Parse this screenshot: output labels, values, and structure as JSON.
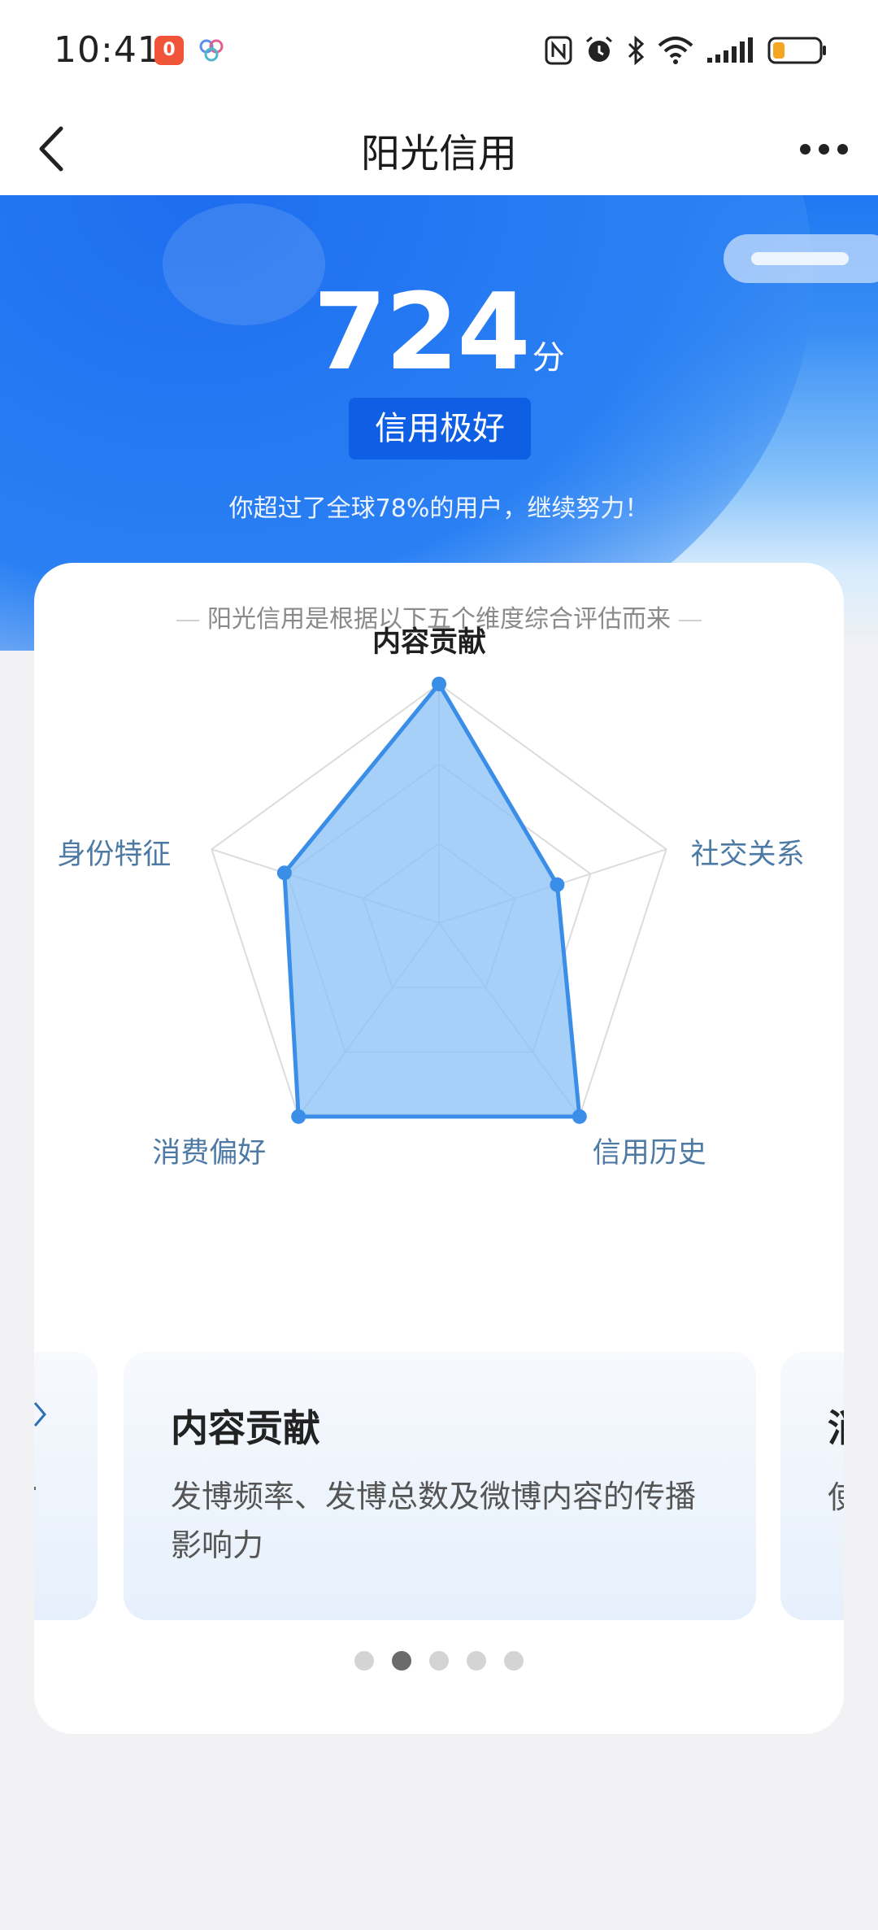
{
  "status_bar": {
    "time": "10:41",
    "notification_badge": "0",
    "icons": [
      "nfc-icon",
      "alarm-icon",
      "bluetooth-icon",
      "wifi-icon",
      "signal-icon",
      "battery-icon"
    ]
  },
  "nav": {
    "title": "阳光信用",
    "back_icon": "chevron-left-icon",
    "more_icon": "more-icon"
  },
  "hero": {
    "score": "724",
    "score_unit": "分",
    "level": "信用极好",
    "rank_text": "你超过了全球78%的用户，继续努力！"
  },
  "card": {
    "subtitle": "阳光信用是根据以下五个维度综合评估而来",
    "radar": {
      "type": "radar",
      "axes": [
        {
          "label": "内容贡献",
          "value": 1.0,
          "active": true
        },
        {
          "label": "社交关系",
          "value": 0.52
        },
        {
          "label": "信用历史",
          "value": 1.0
        },
        {
          "label": "消费偏好",
          "value": 1.0
        },
        {
          "label": "身份特征",
          "value": 0.68
        }
      ],
      "rings": 3,
      "colors": {
        "line": "#3a8ee8",
        "fill": "#8ec3f6",
        "grid": "#dcdcdc"
      }
    },
    "carousel": {
      "slides": [
        {
          "title": "内容贡献",
          "description": "发博频率、发博总数及微博内容的传播影响力"
        }
      ],
      "next_partial": {
        "title": "消",
        "description": "使"
      },
      "active_index": 1,
      "count": 5
    }
  }
}
